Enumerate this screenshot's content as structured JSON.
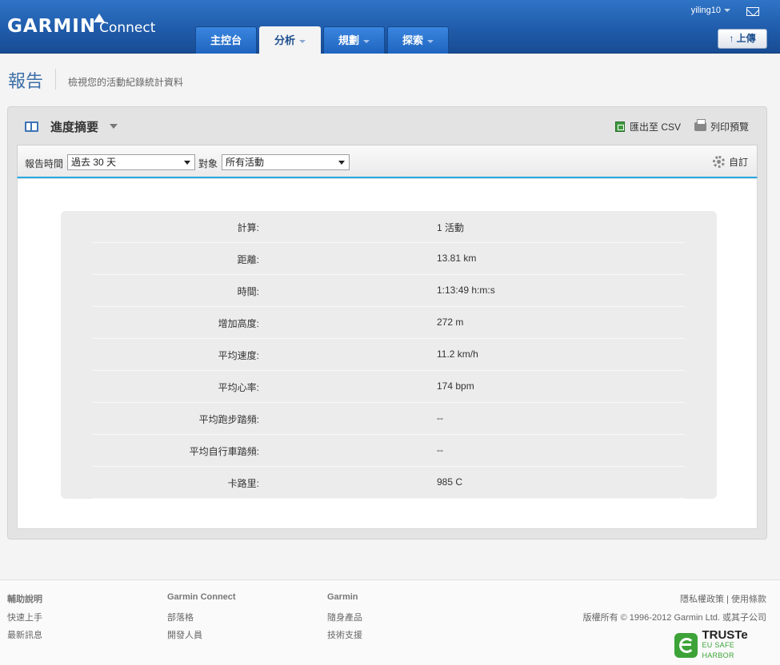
{
  "header": {
    "logo_text": "GARMIN",
    "logo_product": "Connect",
    "username": "yiling10",
    "tabs": [
      {
        "label": "主控台",
        "active": false,
        "has_menu": false
      },
      {
        "label": "分析",
        "active": true,
        "has_menu": true
      },
      {
        "label": "規劃",
        "active": false,
        "has_menu": true
      },
      {
        "label": "探索",
        "active": false,
        "has_menu": true
      }
    ],
    "upload_label": "上傳",
    "icons": {
      "mail": "mail-icon",
      "upload": "arrow-up-icon"
    },
    "colors": {
      "bar": "#1f5aa8",
      "active_tab": "#f4f4f4"
    }
  },
  "page": {
    "title": "報告",
    "subtitle": "檢視您的活動紀錄統計資料"
  },
  "report": {
    "title": "進度摘要",
    "export_label": "匯出至 CSV",
    "print_label": "列印預覽",
    "filters": {
      "period_label": "報告時間",
      "period_value": "過去 30 天",
      "target_label": "對象",
      "target_value": "所有活動",
      "custom_label": "自訂"
    },
    "rows": [
      {
        "label": "計算:",
        "value": "1 活動"
      },
      {
        "label": "距離:",
        "value": "13.81 km"
      },
      {
        "label": "時間:",
        "value": "1:13:49 h:m:s"
      },
      {
        "label": "增加高度:",
        "value": "272 m"
      },
      {
        "label": "平均速度:",
        "value": "11.2 km/h"
      },
      {
        "label": "平均心率:",
        "value": "174 bpm"
      },
      {
        "label": "平均跑步踏頻:",
        "value": "--"
      },
      {
        "label": "平均自行車踏頻:",
        "value": "--"
      },
      {
        "label": "卡路里:",
        "value": "985 C"
      }
    ],
    "accent_color": "#28a8e0"
  },
  "footer": {
    "help": {
      "title": "輔助說明",
      "links": [
        "快速上手",
        "最新訊息"
      ]
    },
    "connect": {
      "title": "Garmin Connect",
      "links": [
        "部落格",
        "開發人員"
      ]
    },
    "garmin": {
      "title": "Garmin",
      "links": [
        "隨身產品",
        "技術支援"
      ]
    },
    "legal": "隱私權政策 | 使用條款",
    "copyright": "版權所有 © 1996-2012 Garmin Ltd. 或其子公司",
    "truste_main": "TRUSTe",
    "truste_sub": "EU SAFE HARBOR"
  }
}
